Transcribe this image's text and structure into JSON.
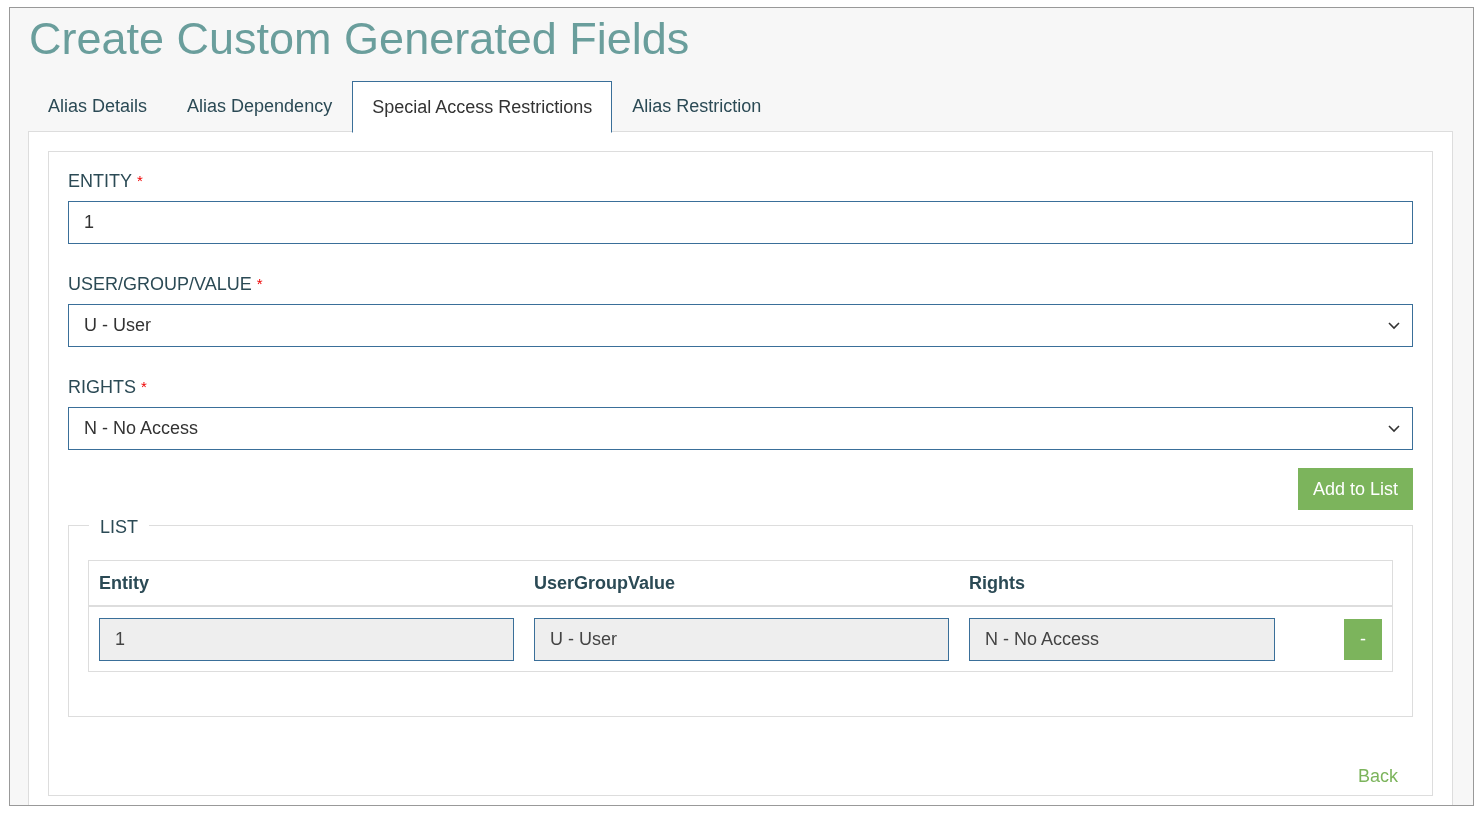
{
  "page": {
    "title": "Create Custom Generated Fields"
  },
  "tabs": [
    {
      "label": "Alias Details",
      "selected": false
    },
    {
      "label": "Alias Dependency",
      "selected": false
    },
    {
      "label": "Special Access Restrictions",
      "selected": true
    },
    {
      "label": "Alias Restriction",
      "selected": false
    }
  ],
  "form": {
    "fields": [
      {
        "kind": "text",
        "label": "ENTITY",
        "required_mark": "*",
        "value": "1"
      },
      {
        "kind": "select",
        "label": "USER/GROUP/VALUE",
        "required_mark": "*",
        "value": "U - User"
      },
      {
        "kind": "select",
        "label": "RIGHTS",
        "required_mark": "*",
        "value": "N - No Access"
      }
    ],
    "add_button": "Add to List"
  },
  "list": {
    "legend": "LIST",
    "columns": [
      "Entity",
      "UserGroupValue",
      "Rights"
    ],
    "rows": [
      {
        "cells": [
          "1",
          "U - User",
          "N - No Access"
        ],
        "remove_button": "-"
      }
    ]
  },
  "back_link": "Back"
}
